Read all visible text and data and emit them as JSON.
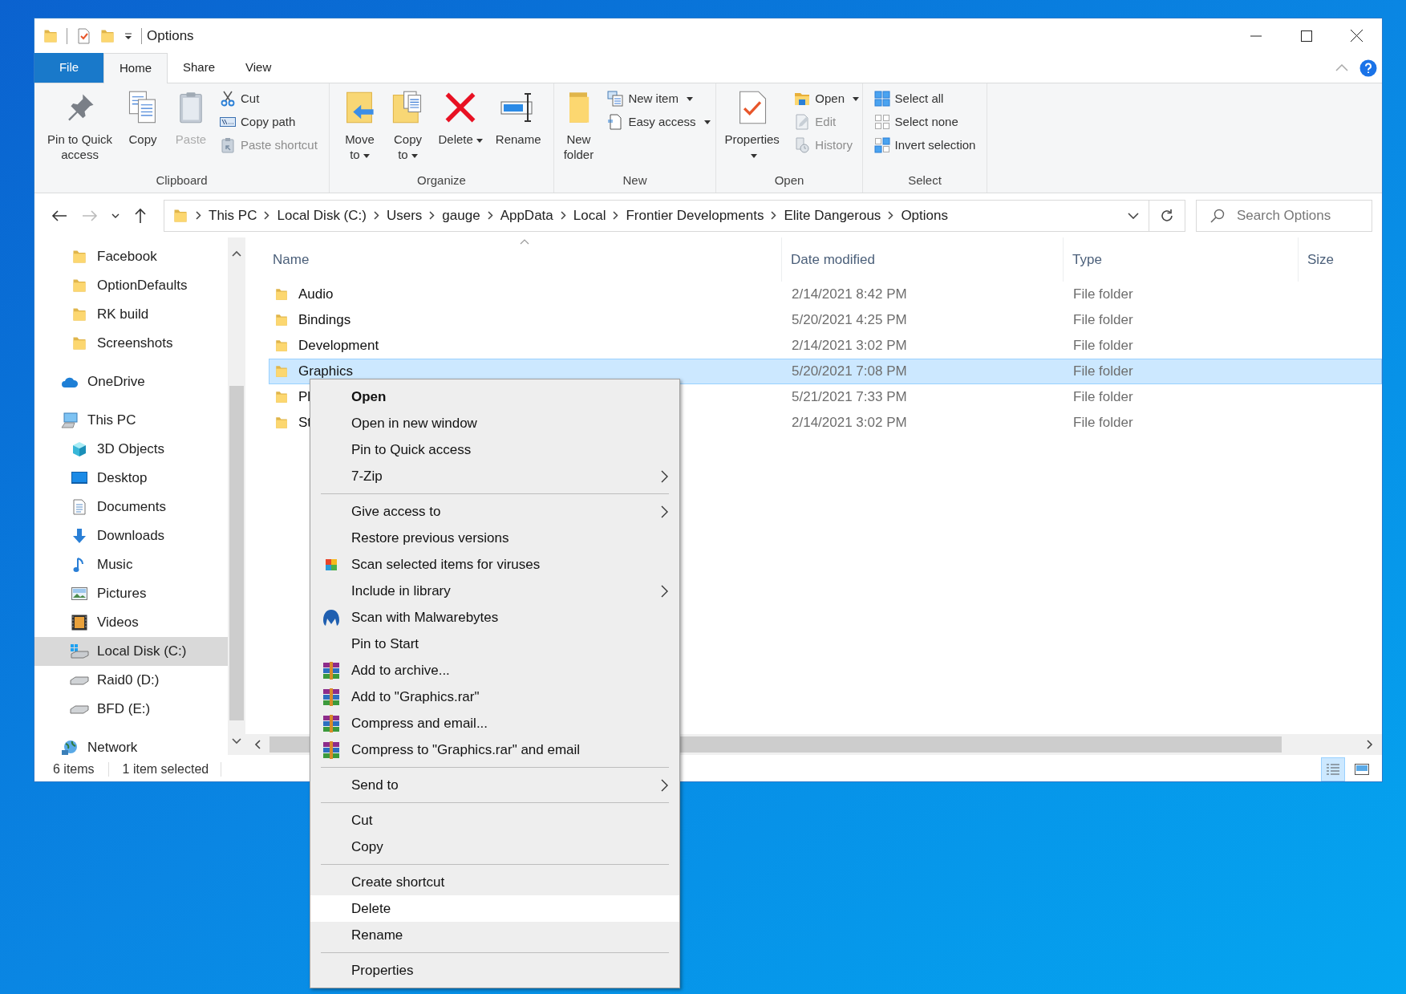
{
  "window": {
    "title": "Options"
  },
  "ribbon_tabs": [
    {
      "label": "File",
      "kind": "backstage",
      "selected": false
    },
    {
      "label": "Home",
      "kind": "tab",
      "selected": true
    },
    {
      "label": "Share",
      "kind": "tab",
      "selected": false
    },
    {
      "label": "View",
      "kind": "tab",
      "selected": false
    }
  ],
  "ribbon_groups": [
    {
      "label": "Clipboard",
      "commands": [
        {
          "label_lines": [
            "Pin to Quick",
            "access"
          ],
          "kind": "large",
          "disabled": false,
          "dropdown": false
        },
        {
          "label_lines": [
            "Copy"
          ],
          "kind": "large",
          "disabled": false,
          "dropdown": false
        },
        {
          "label_lines": [
            "Paste"
          ],
          "kind": "large",
          "disabled": true,
          "dropdown": false
        },
        {
          "label_lines": [
            "Cut"
          ],
          "kind": "small",
          "disabled": false,
          "dropdown": false
        },
        {
          "label_lines": [
            "Copy path"
          ],
          "kind": "small",
          "disabled": false,
          "dropdown": false
        },
        {
          "label_lines": [
            "Paste shortcut"
          ],
          "kind": "small",
          "disabled": true,
          "dropdown": false
        }
      ]
    },
    {
      "label": "Organize",
      "commands": [
        {
          "label_lines": [
            "Move",
            "to"
          ],
          "kind": "large",
          "disabled": false,
          "dropdown": true
        },
        {
          "label_lines": [
            "Copy",
            "to"
          ],
          "kind": "large",
          "disabled": false,
          "dropdown": true
        },
        {
          "label_lines": [
            "Delete"
          ],
          "kind": "large",
          "disabled": false,
          "dropdown": true
        },
        {
          "label_lines": [
            "Rename"
          ],
          "kind": "large",
          "disabled": false,
          "dropdown": false
        }
      ]
    },
    {
      "label": "New",
      "commands": [
        {
          "label_lines": [
            "New",
            "folder"
          ],
          "kind": "large",
          "disabled": false,
          "dropdown": false
        },
        {
          "label_lines": [
            "New item"
          ],
          "kind": "small",
          "disabled": false,
          "dropdown": true
        },
        {
          "label_lines": [
            "Easy access"
          ],
          "kind": "small",
          "disabled": false,
          "dropdown": true
        }
      ]
    },
    {
      "label": "Open",
      "commands": [
        {
          "label_lines": [
            "Properties"
          ],
          "kind": "large",
          "disabled": false,
          "dropdown": true
        },
        {
          "label_lines": [
            "Open"
          ],
          "kind": "small",
          "disabled": false,
          "dropdown": true
        },
        {
          "label_lines": [
            "Edit"
          ],
          "kind": "small",
          "disabled": true,
          "dropdown": false
        },
        {
          "label_lines": [
            "History"
          ],
          "kind": "small",
          "disabled": true,
          "dropdown": false
        }
      ]
    },
    {
      "label": "Select",
      "commands": [
        {
          "label_lines": [
            "Select all"
          ],
          "kind": "small",
          "disabled": false,
          "dropdown": false
        },
        {
          "label_lines": [
            "Select none"
          ],
          "kind": "small",
          "disabled": false,
          "dropdown": false
        },
        {
          "label_lines": [
            "Invert selection"
          ],
          "kind": "small",
          "disabled": false,
          "dropdown": false
        }
      ]
    }
  ],
  "address_bar": {
    "breadcrumbs": [
      "This PC",
      "Local Disk (C:)",
      "Users",
      "gauge",
      "AppData",
      "Local",
      "Frontier Developments",
      "Elite Dangerous",
      "Options"
    ]
  },
  "search": {
    "placeholder": "Search Options"
  },
  "nav_pane": {
    "quick_access_children": [
      {
        "label": "Facebook",
        "selected": false
      },
      {
        "label": "OptionDefaults",
        "selected": false
      },
      {
        "label": "RK build",
        "selected": false
      },
      {
        "label": "Screenshots",
        "selected": false
      }
    ],
    "items": [
      {
        "label": "OneDrive",
        "selected": false
      },
      {
        "label": "This PC",
        "selected": false,
        "children": [
          {
            "label": "3D Objects",
            "selected": false
          },
          {
            "label": "Desktop",
            "selected": false
          },
          {
            "label": "Documents",
            "selected": false
          },
          {
            "label": "Downloads",
            "selected": false
          },
          {
            "label": "Music",
            "selected": false
          },
          {
            "label": "Pictures",
            "selected": false
          },
          {
            "label": "Videos",
            "selected": false
          },
          {
            "label": "Local Disk (C:)",
            "selected": true
          },
          {
            "label": "Raid0 (D:)",
            "selected": false
          },
          {
            "label": "BFD (E:)",
            "selected": false
          }
        ]
      },
      {
        "label": "Network",
        "selected": false
      }
    ]
  },
  "file_list": {
    "columns": [
      "Name",
      "Date modified",
      "Type",
      "Size"
    ],
    "rows": [
      {
        "name": "Audio",
        "date_modified": "2/14/2021 8:42 PM",
        "type": "File folder",
        "selected": false
      },
      {
        "name": "Bindings",
        "date_modified": "5/20/2021 4:25 PM",
        "type": "File folder",
        "selected": false
      },
      {
        "name": "Development",
        "date_modified": "2/14/2021 3:02 PM",
        "type": "File folder",
        "selected": false
      },
      {
        "name": "Graphics",
        "date_modified": "5/20/2021 7:08 PM",
        "type": "File folder",
        "selected": true
      },
      {
        "name": "Pl",
        "date_modified": "5/21/2021 7:33 PM",
        "type": "File folder",
        "selected": false
      },
      {
        "name": "St",
        "date_modified": "2/14/2021 3:02 PM",
        "type": "File folder",
        "selected": false
      }
    ]
  },
  "status_bar": {
    "item_count": "6 items",
    "selection": "1 item selected"
  },
  "view_buttons": [
    {
      "kind": "details",
      "selected": true
    },
    {
      "kind": "large_icons",
      "selected": false
    }
  ],
  "context_menu": {
    "groups": [
      [
        {
          "label": "Open",
          "kind": "plain",
          "default": true,
          "submenu": false,
          "highlighted": false
        },
        {
          "label": "Open in new window",
          "kind": "plain",
          "default": false,
          "submenu": false,
          "highlighted": false
        },
        {
          "label": "Pin to Quick access",
          "kind": "plain",
          "default": false,
          "submenu": false,
          "highlighted": false
        },
        {
          "label": "7-Zip",
          "kind": "plain",
          "default": false,
          "submenu": true,
          "highlighted": false
        }
      ],
      [
        {
          "label": "Give access to",
          "kind": "plain",
          "default": false,
          "submenu": true,
          "highlighted": false
        },
        {
          "label": "Restore previous versions",
          "kind": "plain",
          "default": false,
          "submenu": false,
          "highlighted": false
        },
        {
          "label": "Scan selected items for viruses",
          "kind": "antivirus",
          "default": false,
          "submenu": false,
          "highlighted": false
        },
        {
          "label": "Include in library",
          "kind": "plain",
          "default": false,
          "submenu": true,
          "highlighted": false
        },
        {
          "label": "Scan with Malwarebytes",
          "kind": "malware_scanner",
          "default": false,
          "submenu": false,
          "highlighted": false
        },
        {
          "label": "Pin to Start",
          "kind": "plain",
          "default": false,
          "submenu": false,
          "highlighted": false
        },
        {
          "label": "Add to archive...",
          "kind": "archiver",
          "default": false,
          "submenu": false,
          "highlighted": false
        },
        {
          "label": "Add to \"Graphics.rar\"",
          "kind": "archiver",
          "default": false,
          "submenu": false,
          "highlighted": false
        },
        {
          "label": "Compress and email...",
          "kind": "archiver",
          "default": false,
          "submenu": false,
          "highlighted": false
        },
        {
          "label": "Compress to \"Graphics.rar\" and email",
          "kind": "archiver",
          "default": false,
          "submenu": false,
          "highlighted": false
        }
      ],
      [
        {
          "label": "Send to",
          "kind": "plain",
          "default": false,
          "submenu": true,
          "highlighted": false
        }
      ],
      [
        {
          "label": "Cut",
          "kind": "plain",
          "default": false,
          "submenu": false,
          "highlighted": false
        },
        {
          "label": "Copy",
          "kind": "plain",
          "default": false,
          "submenu": false,
          "highlighted": false
        }
      ],
      [
        {
          "label": "Create shortcut",
          "kind": "plain",
          "default": false,
          "submenu": false,
          "highlighted": false
        },
        {
          "label": "Delete",
          "kind": "plain",
          "default": false,
          "submenu": false,
          "highlighted": true
        },
        {
          "label": "Rename",
          "kind": "plain",
          "default": false,
          "submenu": false,
          "highlighted": false
        }
      ],
      [
        {
          "label": "Properties",
          "kind": "plain",
          "default": false,
          "submenu": false,
          "highlighted": false
        }
      ]
    ]
  }
}
